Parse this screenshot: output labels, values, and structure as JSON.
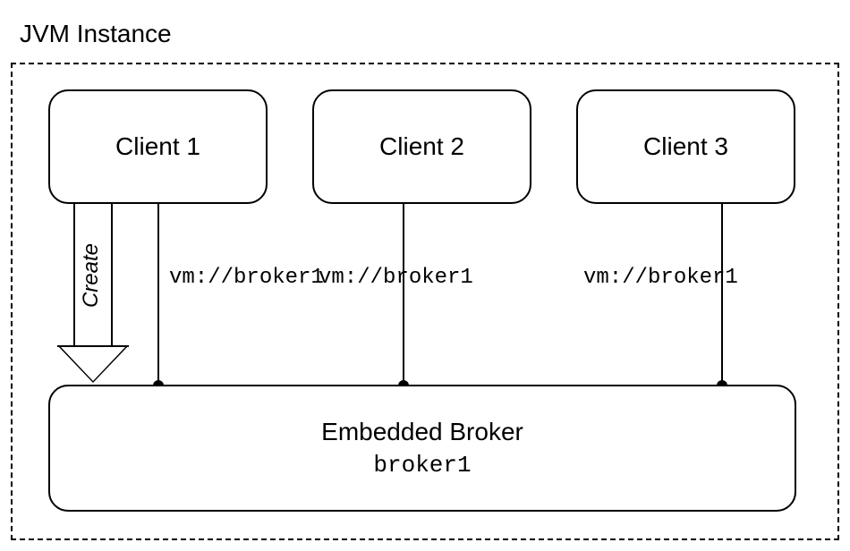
{
  "container": {
    "title": "JVM Instance"
  },
  "clients": {
    "c1": {
      "label": "Client 1",
      "conn": "vm://broker1"
    },
    "c2": {
      "label": "Client 2",
      "conn": "vm://broker1"
    },
    "c3": {
      "label": "Client 3",
      "conn": "vm://broker1"
    }
  },
  "create": {
    "label": "Create"
  },
  "broker": {
    "title": "Embedded Broker",
    "name": "broker1"
  }
}
